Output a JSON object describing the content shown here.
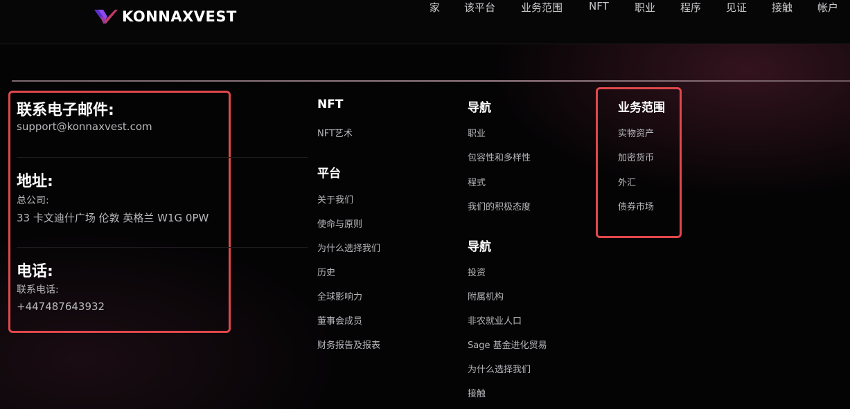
{
  "brand": {
    "name": "KONNAXVEST",
    "colors": {
      "accent_purple": "#7b3fe4",
      "accent_red": "#e0484c"
    }
  },
  "nav": {
    "items": [
      "家",
      "该平台",
      "业务范围",
      "NFT",
      "职业",
      "程序",
      "见证",
      "接触",
      "帐户"
    ]
  },
  "contact": {
    "email_heading": "联系电子邮件:",
    "email": "support@konnaxvest.com",
    "address_heading": "地址:",
    "address_label": "总公司:",
    "address": "33 卡文迪什广场 伦敦 英格兰 W1G 0PW",
    "phone_heading": "电话:",
    "phone_label": "联系电话:",
    "phone": "+447487643932"
  },
  "columns": {
    "nft": {
      "heading": "NFT",
      "links": [
        "NFT艺术"
      ]
    },
    "platform": {
      "heading": "平台",
      "links": [
        "关于我们",
        "使命与原则",
        "为什么选择我们",
        "历史",
        "全球影响力",
        "董事会成员",
        "财务报告及报表"
      ]
    },
    "nav1": {
      "heading": "导航",
      "links": [
        "职业",
        "包容性和多样性",
        "程式",
        "我们的积极态度"
      ]
    },
    "nav2": {
      "heading": "导航",
      "links": [
        "投资",
        "附属机构",
        "非农就业人口",
        "Sage 基金进化贸易",
        "为什么选择我们",
        "接触"
      ]
    },
    "business": {
      "heading": "业务范围",
      "links": [
        "实物资产",
        "加密货币",
        "外汇",
        "债券市场"
      ]
    }
  }
}
